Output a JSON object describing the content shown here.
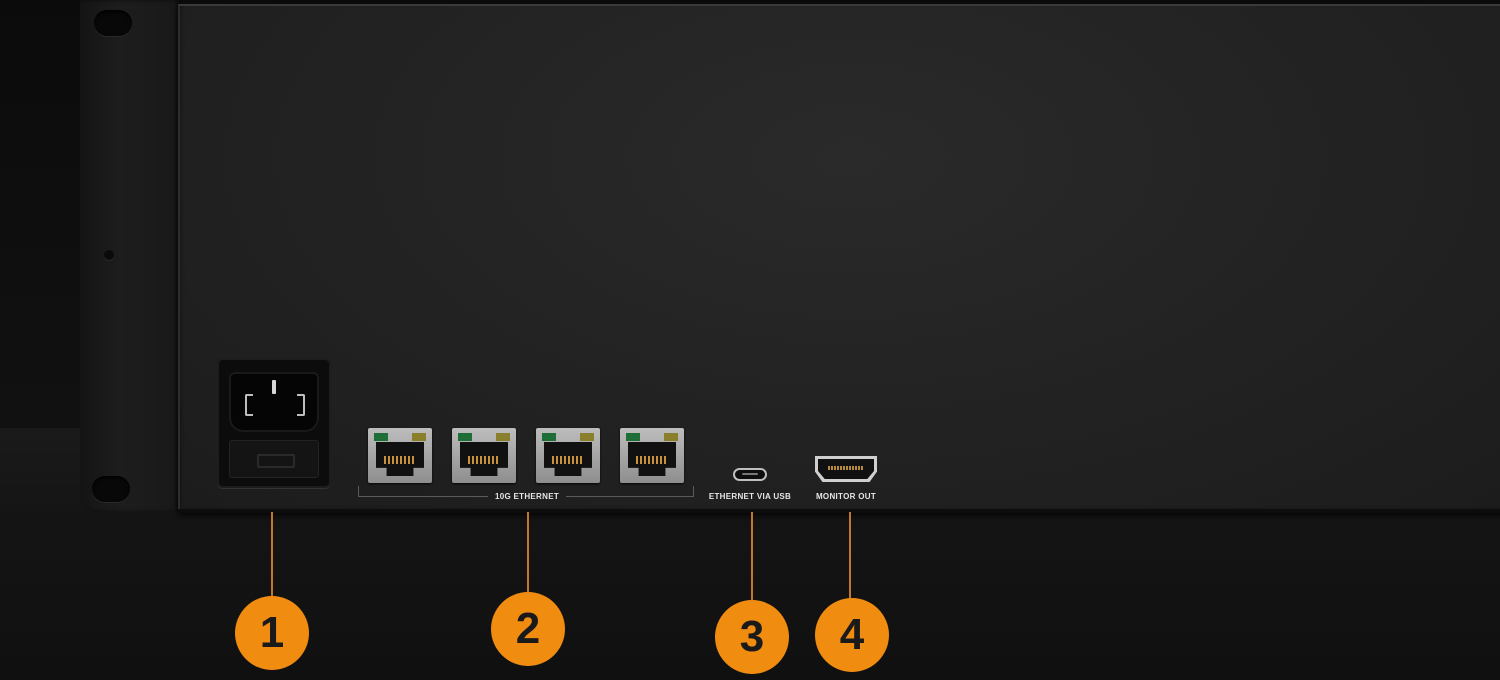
{
  "ports": {
    "power": {
      "icon": "iec-power-inlet-icon"
    },
    "ethernet": {
      "label": "10G ETHERNET",
      "count": 4,
      "icon": "rj45-port-icon"
    },
    "usb": {
      "label": "ETHERNET VIA USB",
      "icon": "usb-c-port-icon"
    },
    "monitor": {
      "label": "MONITOR OUT",
      "icon": "hdmi-port-icon"
    }
  },
  "callouts": [
    {
      "number": "1"
    },
    {
      "number": "2"
    },
    {
      "number": "3"
    },
    {
      "number": "4"
    }
  ],
  "colors": {
    "callout": "#f08c0f",
    "leader_line": "#c2782a",
    "panel": "#222222",
    "label_text": "#e6e6e6"
  }
}
